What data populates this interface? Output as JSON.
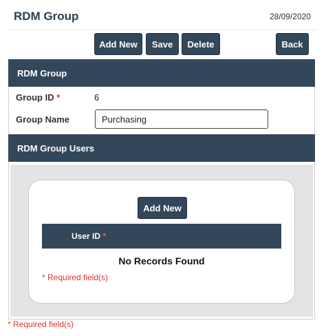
{
  "header": {
    "title": "RDM Group",
    "date": "28/09/2020"
  },
  "toolbar": {
    "add_new": "Add New",
    "save": "Save",
    "delete": "Delete",
    "back": "Back"
  },
  "group_section": {
    "title": "RDM Group",
    "group_id_label": "Group ID",
    "required_marker": "*",
    "group_id_value": "6",
    "group_name_label": "Group Name",
    "group_name_value": "Purchasing"
  },
  "users_section": {
    "title": "RDM Group Users",
    "add_new": "Add New",
    "columns": [
      "User ID"
    ],
    "required_marker": "*",
    "empty_message": "No Records Found",
    "required_note": "* Required field(s)"
  },
  "footer": {
    "required_note": "* Required field(s)"
  },
  "colors": {
    "header_bar": "#33475b",
    "required": "#d9362f",
    "panel_bg": "#e4e4e4"
  }
}
